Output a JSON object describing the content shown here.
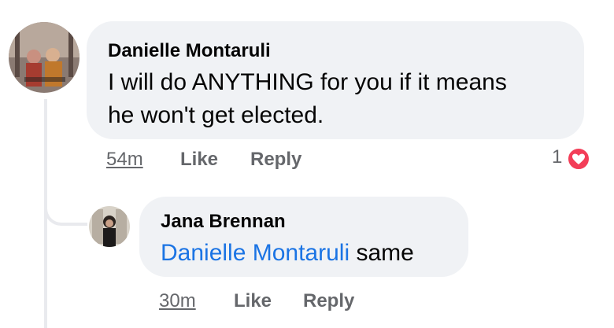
{
  "comment": {
    "author": "Danielle Montaruli",
    "text_line_1": "I will do ANYTHING for you if it means",
    "text_line_2": "he won't get elected.",
    "timestamp": "54m",
    "like_label": "Like",
    "reply_label": "Reply",
    "reaction_count": "1",
    "reaction_type": "heart-icon",
    "reaction_color": "#f33e58"
  },
  "reply": {
    "author": "Jana Brennan",
    "mention": "Danielle Montaruli",
    "text": " same",
    "timestamp": "30m",
    "like_label": "Like",
    "reply_label": "Reply"
  },
  "colors": {
    "bubble": "#f0f2f5",
    "meta": "#65676b",
    "mention": "#1b74e4"
  }
}
